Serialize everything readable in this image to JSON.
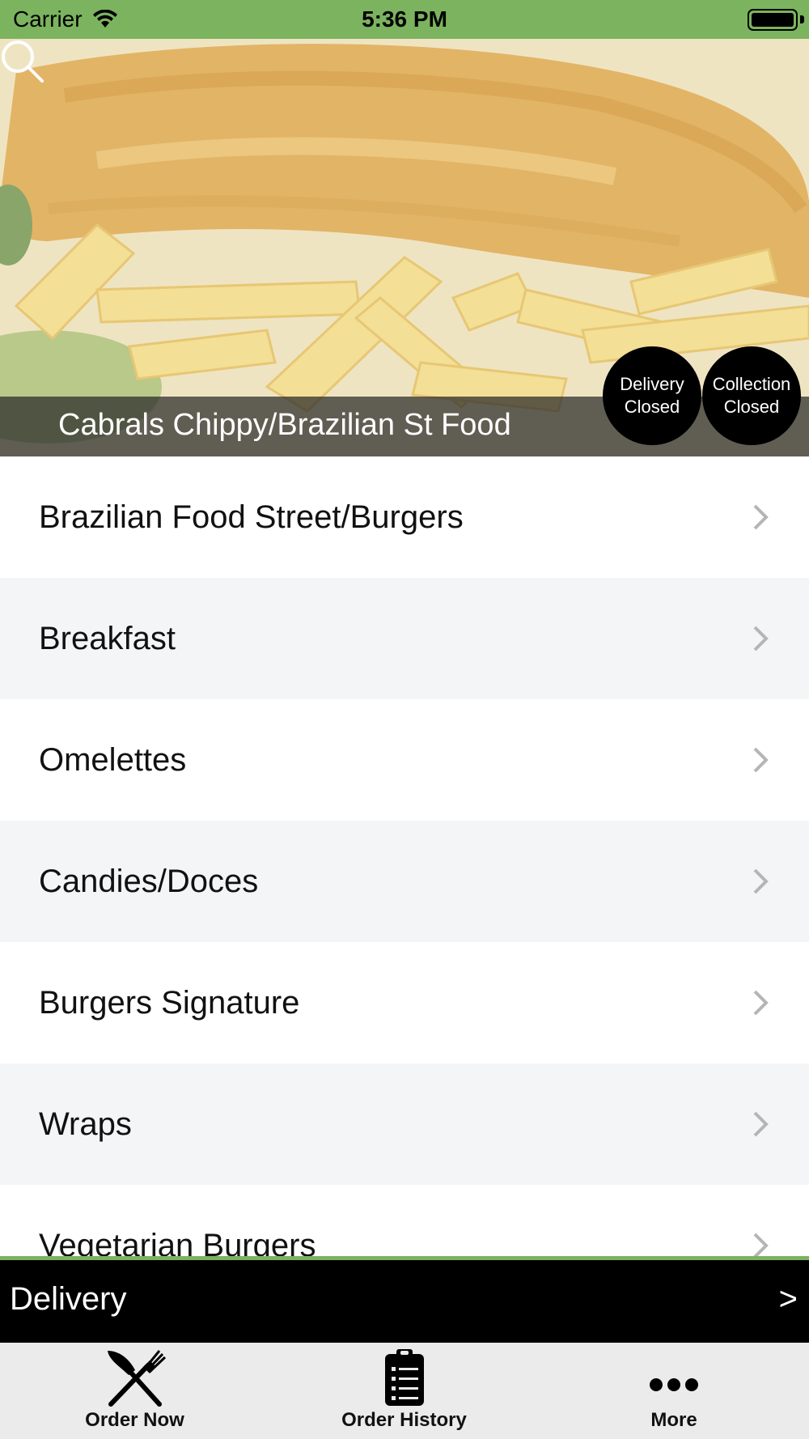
{
  "status_bar": {
    "carrier": "Carrier",
    "time": "5:36 PM",
    "background": "#7cb35f"
  },
  "hero": {
    "restaurant_name": "Cabrals Chippy/Brazilian St Food",
    "search_icon": "search-icon",
    "delivery_status": {
      "line1": "Delivery",
      "line2": "Closed"
    },
    "collection_status": {
      "line1": "Collection",
      "line2": "Closed"
    }
  },
  "menu": {
    "items": [
      {
        "label": "Brazilian Food Street/Burgers"
      },
      {
        "label": "Breakfast"
      },
      {
        "label": "Omelettes"
      },
      {
        "label": "Candies/Doces"
      },
      {
        "label": "Burgers Signature"
      },
      {
        "label": "Wraps"
      },
      {
        "label": "Vegetarian Burgers"
      }
    ],
    "chevron_icon": "chevron-right-icon"
  },
  "delivery_bar": {
    "label": "Delivery",
    "arrow": ">"
  },
  "tab_bar": {
    "tabs": [
      {
        "label": "Order Now",
        "icon": "fork-knife-icon"
      },
      {
        "label": "Order History",
        "icon": "clipboard-list-icon"
      },
      {
        "label": "More",
        "icon": "more-dots-icon"
      }
    ]
  },
  "colors": {
    "accent_green": "#7cb35f",
    "row_alt": "#f4f5f7",
    "delivery_bar": "#000000",
    "tab_bar": "#ebebeb"
  }
}
